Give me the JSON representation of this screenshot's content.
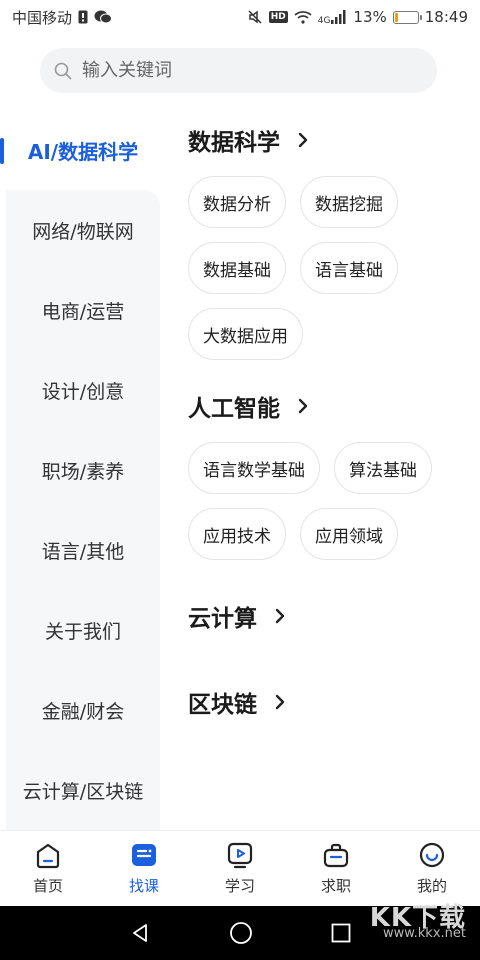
{
  "status_bar": {
    "carrier": "中国移动",
    "network": "4G",
    "battery_text": "13%",
    "battery_level": 0.13,
    "time": "18:49"
  },
  "search": {
    "placeholder": "输入关键词"
  },
  "sidebar": {
    "items": [
      {
        "label": "AI/数据科学",
        "active": true
      },
      {
        "label": "网络/物联网"
      },
      {
        "label": "电商/运营"
      },
      {
        "label": "设计/创意"
      },
      {
        "label": "职场/素养"
      },
      {
        "label": "语言/其他"
      },
      {
        "label": "关于我们"
      },
      {
        "label": "金融/财会"
      },
      {
        "label": "云计算/区块链"
      }
    ]
  },
  "sections": [
    {
      "title": "数据科学",
      "chips": [
        "数据分析",
        "数据挖掘",
        "数据基础",
        "语言基础",
        "大数据应用"
      ]
    },
    {
      "title": "人工智能",
      "chips": [
        "语言数学基础",
        "算法基础",
        "应用技术",
        "应用领域"
      ]
    },
    {
      "title": "云计算",
      "chips": []
    },
    {
      "title": "区块链",
      "chips": []
    }
  ],
  "tabbar": {
    "tabs": [
      {
        "label": "首页",
        "icon": "home-icon"
      },
      {
        "label": "找课",
        "icon": "course-icon",
        "active": true
      },
      {
        "label": "学习",
        "icon": "learn-icon"
      },
      {
        "label": "求职",
        "icon": "job-icon"
      },
      {
        "label": "我的",
        "icon": "profile-icon"
      }
    ]
  },
  "colors": {
    "accent": "#1a5fdb",
    "sidebar_bg": "#f6f7f8",
    "battery_low": "#f39c12"
  },
  "watermark": {
    "logo": "KK下载",
    "url": "www.kkx.net"
  }
}
